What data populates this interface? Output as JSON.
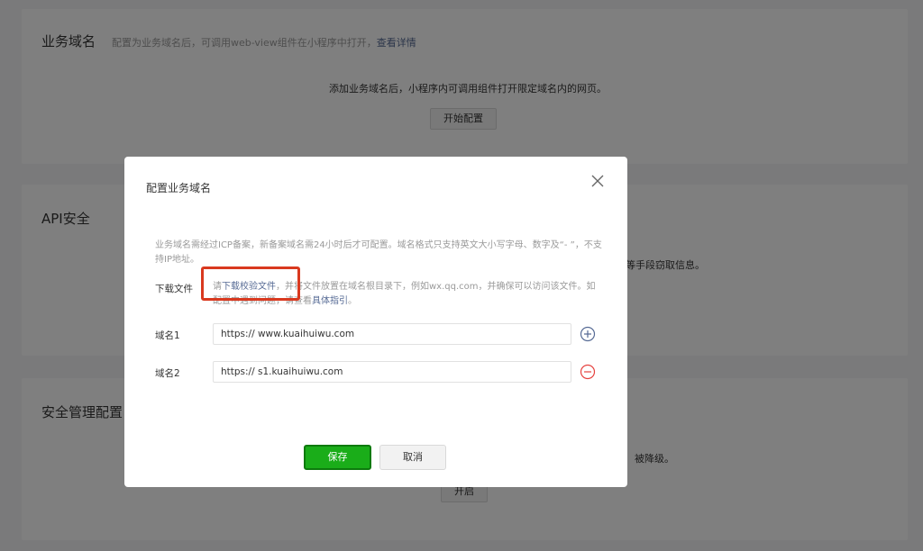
{
  "sections": {
    "business": {
      "title": "业务域名",
      "desc": "配置为业务域名后，可调用web-view组件在小程序中打开，",
      "desc_link": "查看详情",
      "info": "添加业务域名后，小程序内可调用组件打开限定域名内的网页。",
      "button": "开始配置"
    },
    "api": {
      "title": "API安全",
      "partial_text": "等手段窃取信息。"
    },
    "security": {
      "title": "安全管理配置",
      "partial_text": "被降级。",
      "button": "开启"
    }
  },
  "modal": {
    "title": "配置业务域名",
    "note": "业务域名需经过ICP备案，新备案域名需24小时后才可配置。域名格式只支持英文大小写字母、数字及“- ”，不支持IP地址。",
    "download": {
      "label": "下载文件",
      "text_before": "请",
      "link": "下载校验文件",
      "text_after": "，并将文件放置在域名根目录下，例如wx.qq.com，并确保可以访问该文件。如配置中遇到问题，请查看",
      "guide_link": "具体指引",
      "text_end": "。"
    },
    "domains": [
      {
        "label": "域名1",
        "value": "https:// www.kuaihuiwu.com",
        "action_icon": "plus-circle-icon"
      },
      {
        "label": "域名2",
        "value": "https:// s1.kuaihuiwu.com",
        "action_icon": "minus-circle-icon"
      }
    ],
    "save_label": "保存",
    "cancel_label": "取消"
  },
  "colors": {
    "primary_green": "#1aad19",
    "link_blue": "#576b95",
    "remove_red": "#e64340",
    "highlight_red": "#d9391f"
  }
}
